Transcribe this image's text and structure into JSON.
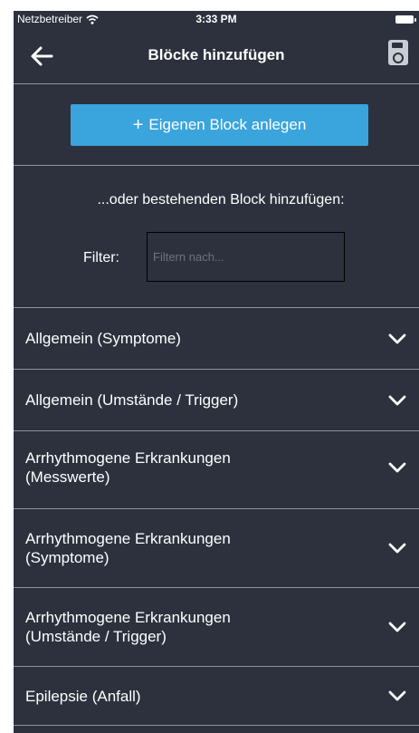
{
  "status_bar": {
    "carrier": "Netzbetreiber",
    "time": "3:33 PM"
  },
  "nav": {
    "back_icon": "arrow-left-icon",
    "title": "Blöcke hinzufügen",
    "save_icon": "floppy-save-icon"
  },
  "add_block_button": {
    "plus": "+",
    "label": "Eigenen Block anlegen"
  },
  "subtitle": "...oder bestehenden Block hinzufügen:",
  "filter": {
    "label": "Filter:",
    "placeholder": "Filtern nach...",
    "value": ""
  },
  "categories": [
    {
      "line1": "Allgemein (Symptome)",
      "line2": ""
    },
    {
      "line1": "Allgemein (Umstände / Trigger)",
      "line2": ""
    },
    {
      "line1": "Arrhythmogene Erkrankungen",
      "line2": "(Messwerte)"
    },
    {
      "line1": "Arrhythmogene Erkrankungen",
      "line2": "(Symptome)"
    },
    {
      "line1": "Arrhythmogene Erkrankungen",
      "line2": "(Umstände / Trigger)"
    },
    {
      "line1": "Epilepsie (Anfall)",
      "line2": ""
    }
  ],
  "colors": {
    "background": "#2c313d",
    "accent": "#3aa4dc",
    "divider": "#8e939c"
  }
}
